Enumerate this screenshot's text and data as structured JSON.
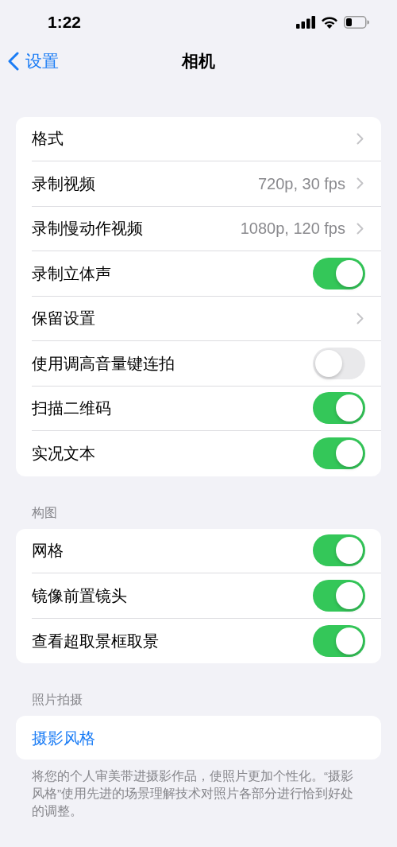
{
  "status_bar": {
    "time": "1:22"
  },
  "nav": {
    "back": "设置",
    "title": "相机"
  },
  "sections": [
    {
      "rows": [
        {
          "kind": "chevron",
          "label": "格式"
        },
        {
          "kind": "chevron",
          "label": "录制视频",
          "value": "720p, 30 fps"
        },
        {
          "kind": "chevron",
          "label": "录制慢动作视频",
          "value": "1080p, 120 fps"
        },
        {
          "kind": "toggle",
          "label": "录制立体声",
          "on": true
        },
        {
          "kind": "chevron",
          "label": "保留设置"
        },
        {
          "kind": "toggle",
          "label": "使用调高音量键连拍",
          "on": false
        },
        {
          "kind": "toggle",
          "label": "扫描二维码",
          "on": true
        },
        {
          "kind": "toggle",
          "label": "实况文本",
          "on": true
        }
      ]
    },
    {
      "header": "构图",
      "rows": [
        {
          "kind": "toggle",
          "label": "网格",
          "on": true
        },
        {
          "kind": "toggle",
          "label": "镜像前置镜头",
          "on": true
        },
        {
          "kind": "toggle",
          "label": "查看超取景框取景",
          "on": true
        }
      ]
    },
    {
      "header": "照片拍摄",
      "rows": [
        {
          "kind": "link",
          "label": "摄影风格"
        }
      ],
      "footer": "将您的个人审美带进摄影作品，使照片更加个性化。“摄影风格”使用先进的场景理解技术对照片各部分进行恰到好处的调整。"
    }
  ]
}
